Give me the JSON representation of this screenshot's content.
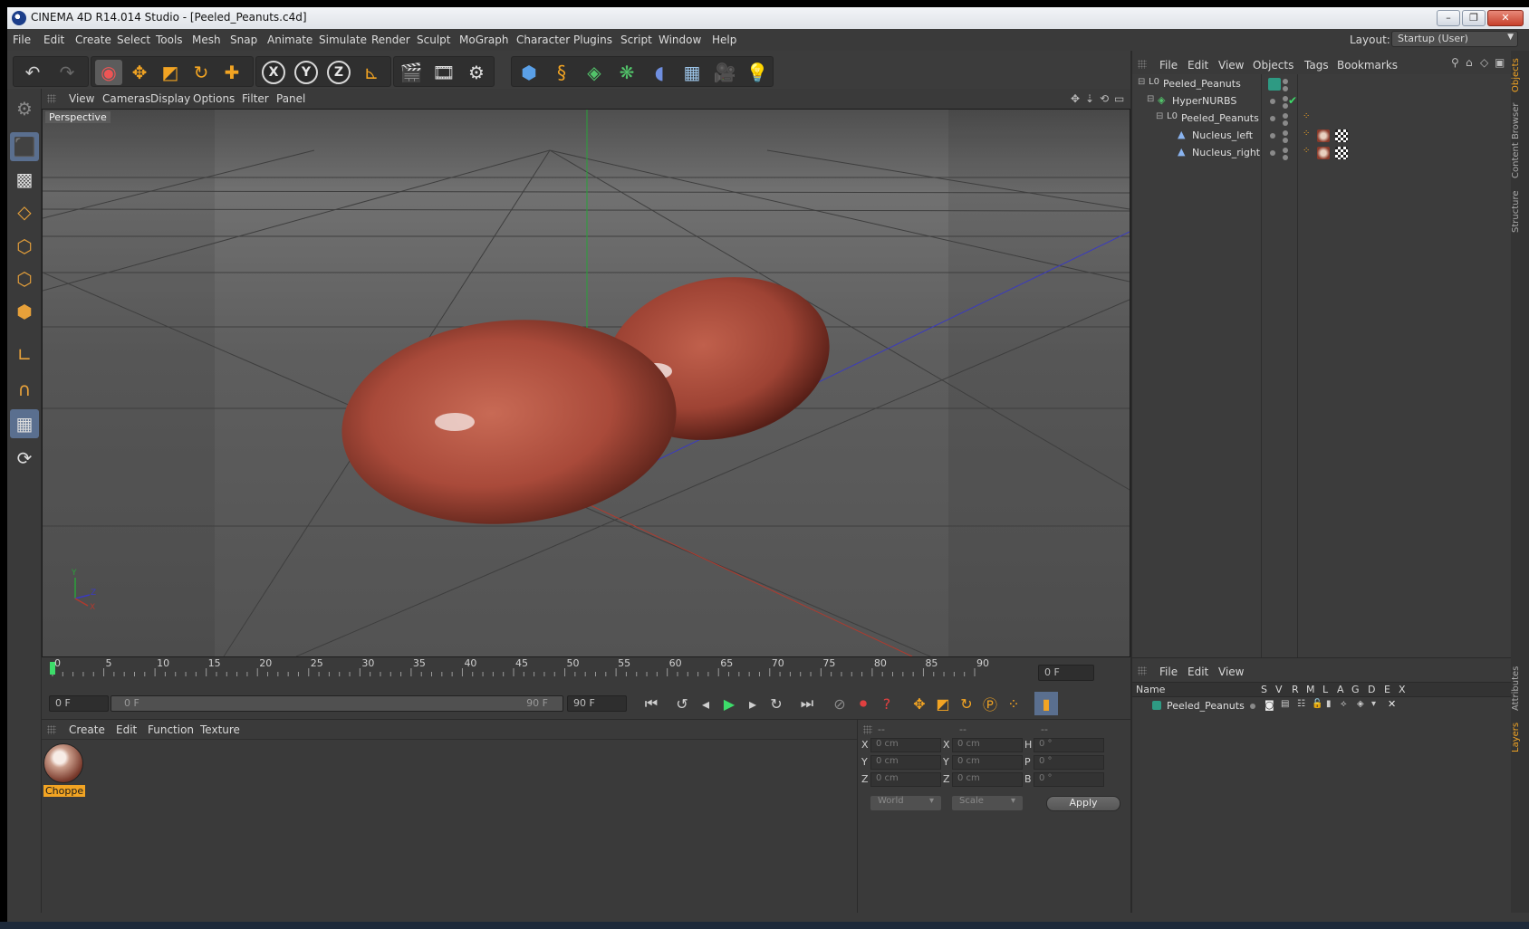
{
  "window": {
    "title": "CINEMA 4D R14.014 Studio - [Peeled_Peanuts.c4d]",
    "minimize": "–",
    "restore": "❐",
    "close": "✕"
  },
  "menubar": {
    "items": [
      "File",
      "Edit",
      "Create",
      "Select",
      "Tools",
      "Mesh",
      "Snap",
      "Animate",
      "Simulate",
      "Render",
      "Sculpt",
      "MoGraph",
      "Character",
      "Plugins",
      "Script",
      "Window",
      "Help"
    ],
    "layout_label": "Layout:",
    "layout_value": "Startup (User)"
  },
  "toolbar": {
    "axis_x": "X",
    "axis_y": "Y",
    "axis_z": "Z"
  },
  "viewport": {
    "menu": [
      "View",
      "Cameras",
      "Display",
      "Options",
      "Filter",
      "Panel"
    ],
    "label": "Perspective",
    "axis_y": "Y",
    "axis_x": "X",
    "axis_z": "Z"
  },
  "timeline": {
    "ticks": [
      "0",
      "5",
      "10",
      "15",
      "20",
      "25",
      "30",
      "35",
      "40",
      "45",
      "50",
      "55",
      "60",
      "65",
      "70",
      "75",
      "80",
      "85",
      "90"
    ],
    "current_frame": "0 F",
    "start_frame": "0 F",
    "range_start": "0 F",
    "range_end": "90 F",
    "end_frame": "90 F"
  },
  "material_manager": {
    "menu": [
      "Create",
      "Edit",
      "Function",
      "Texture"
    ],
    "materials": [
      {
        "label": "Choppe"
      }
    ]
  },
  "coordinates": {
    "headers": [
      "--",
      "--",
      "--"
    ],
    "rows": [
      {
        "l1": "X",
        "v1": "0 cm",
        "l2": "X",
        "v2": "0 cm",
        "l3": "H",
        "v3": "0 °"
      },
      {
        "l1": "Y",
        "v1": "0 cm",
        "l2": "Y",
        "v2": "0 cm",
        "l3": "P",
        "v3": "0 °"
      },
      {
        "l1": "Z",
        "v1": "0 cm",
        "l2": "Z",
        "v2": "0 cm",
        "l3": "B",
        "v3": "0 °"
      }
    ],
    "space": "World",
    "mode": "Scale",
    "apply": "Apply"
  },
  "object_manager": {
    "menu": [
      "File",
      "Edit",
      "View",
      "Objects",
      "Tags",
      "Bookmarks"
    ],
    "objects": [
      {
        "name": "Peeled_Peanuts"
      },
      {
        "name": "HyperNURBS"
      },
      {
        "name": "Peeled_Peanuts"
      },
      {
        "name": "Nucleus_left"
      },
      {
        "name": "Nucleus_right"
      }
    ]
  },
  "layer_manager": {
    "menu": [
      "File",
      "Edit",
      "View"
    ],
    "columns": [
      "Name",
      "S",
      "V",
      "R",
      "M",
      "L",
      "A",
      "G",
      "D",
      "E",
      "X"
    ],
    "layers": [
      {
        "name": "Peeled_Peanuts",
        "color": "#2e9a83"
      }
    ]
  },
  "side_tabs": [
    "Objects",
    "Content Browser",
    "Structure",
    "Attributes",
    "Layers"
  ],
  "colors": {
    "accent": "#f2a423",
    "peanut": "#a94a3a",
    "x_axis": "#b03a2e",
    "y_axis": "#2aa03a",
    "z_axis": "#3a3ac0"
  }
}
